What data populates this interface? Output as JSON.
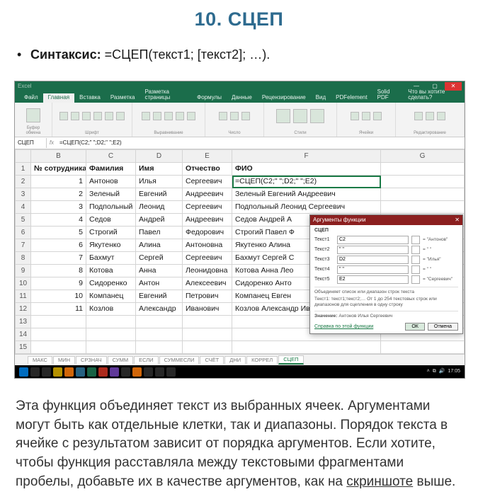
{
  "doc": {
    "heading": "10. СЦЕП",
    "syntax_label": "Синтаксис:",
    "syntax_value": "=СЦЕП(текст1; [текст2]; …).",
    "description_parts": [
      "Эта функция объединяет текст из выбранных ячеек. Аргументами могут быть как отдельные клетки, так и диапазоны. Порядок текста в ячейке с результатом зависит от порядка аргументов. Если хотите, чтобы функция расставляла между текстовыми фрагментами пробелы, добавьте их в качестве аргументов, как на ",
      "скриншоте",
      " выше."
    ]
  },
  "excel": {
    "titlebar": {
      "app": "Excel",
      "close_glyph": "✕",
      "min_glyph": "—",
      "max_glyph": "▢"
    },
    "tabs": [
      "Файл",
      "Главная",
      "Вставка",
      "Разметка",
      "Разметка страницы",
      "Формулы",
      "Данные",
      "Рецензирование",
      "Вид",
      "PDFelement",
      "Solid PDF",
      "Что вы хотите сделать?"
    ],
    "active_tab": 1,
    "ribbon_groups": [
      "Буфер обмена",
      "Шрифт",
      "Выравнивание",
      "Число",
      "Стили",
      "Ячейки",
      "Редактирование"
    ],
    "formula_bar": {
      "namebox": "СЦЕП",
      "fx": "fx",
      "formula": "=СЦЕП(C2;\" \";D2;\" \";E2)"
    },
    "columns": [
      "B",
      "C",
      "D",
      "E",
      "F",
      "G"
    ],
    "header_row": [
      "№ сотрудника",
      "Фамилия",
      "Имя",
      "Отчество",
      "ФИО",
      ""
    ],
    "data_rows": [
      {
        "r": "2",
        "b": "1",
        "c": "Антонов",
        "d": "Илья",
        "e": "Сергеевич",
        "f": "=СЦЕП(C2;\" \";D2;\" \";E2)",
        "sel": true
      },
      {
        "r": "3",
        "b": "2",
        "c": "Зеленый",
        "d": "Евгений",
        "e": "Андреевич",
        "f": "Зеленый Евгений Андреевич"
      },
      {
        "r": "4",
        "b": "3",
        "c": "Подпольный",
        "d": "Леонид",
        "e": "Сергеевич",
        "f": "Подпольный Леонид Сергеевич"
      },
      {
        "r": "5",
        "b": "4",
        "c": "Седов",
        "d": "Андрей",
        "e": "Андреевич",
        "f": "Седов Андрей А"
      },
      {
        "r": "6",
        "b": "5",
        "c": "Строгий",
        "d": "Павел",
        "e": "Федорович",
        "f": "Строгий Павел Ф"
      },
      {
        "r": "7",
        "b": "6",
        "c": "Якутенко",
        "d": "Алина",
        "e": "Антоновна",
        "f": "Якутенко Алина"
      },
      {
        "r": "8",
        "b": "7",
        "c": "Бахмут",
        "d": "Сергей",
        "e": "Сергеевич",
        "f": "Бахмут Сергей С"
      },
      {
        "r": "9",
        "b": "8",
        "c": "Котова",
        "d": "Анна",
        "e": "Леонидовна",
        "f": "Котова Анна Лео"
      },
      {
        "r": "10",
        "b": "9",
        "c": "Сидоренко",
        "d": "Антон",
        "e": "Алексеевич",
        "f": "Сидоренко Анто"
      },
      {
        "r": "11",
        "b": "10",
        "c": "Компанец",
        "d": "Евгений",
        "e": "Петрович",
        "f": "Компанец Евген"
      },
      {
        "r": "12",
        "b": "11",
        "c": "Козлов",
        "d": "Александр",
        "e": "Иванович",
        "f": "Козлов Александр Иванович"
      },
      {
        "r": "13",
        "b": "",
        "c": "",
        "d": "",
        "e": "",
        "f": ""
      },
      {
        "r": "14",
        "b": "",
        "c": "",
        "d": "",
        "e": "",
        "f": ""
      },
      {
        "r": "15",
        "b": "",
        "c": "",
        "d": "",
        "e": "",
        "f": ""
      }
    ],
    "dialog": {
      "title": "Аргументы функции",
      "func": "СЦЕП",
      "rows": [
        {
          "lab": "Текст1",
          "in": "C2",
          "val": "= \"Антонов\""
        },
        {
          "lab": "Текст2",
          "in": "\" \"",
          "val": "= \" \""
        },
        {
          "lab": "Текст3",
          "in": "D2",
          "val": "= \"Илья\""
        },
        {
          "lab": "Текст4",
          "in": "\" \"",
          "val": "= \" \""
        },
        {
          "lab": "Текст5",
          "in": "E2",
          "val": "= \"Сергеевич\""
        }
      ],
      "desc1": "Объединяет список или диапазон строк текста",
      "desc2": "Текст1: текст1;текст2;… От 1 до 254 текстовых строк или диапазонов для сцепления в одну строку",
      "result_label": "Значение:",
      "result_value": "Антонов Илья Сергеевич",
      "help": "Справка по этой функции",
      "ok": "ОК",
      "cancel": "Отмена",
      "close_glyph": "✕"
    },
    "sheet_tabs": [
      "МАКС",
      "МИН",
      "СРЗНАЧ",
      "СУММ",
      "ЕСЛИ",
      "СУММЕСЛИ",
      "СЧЁТ",
      "ДНИ",
      "КОРРЕЛ",
      "СЦЕП"
    ],
    "active_sheet": 9,
    "taskbar_time": "17:05"
  }
}
